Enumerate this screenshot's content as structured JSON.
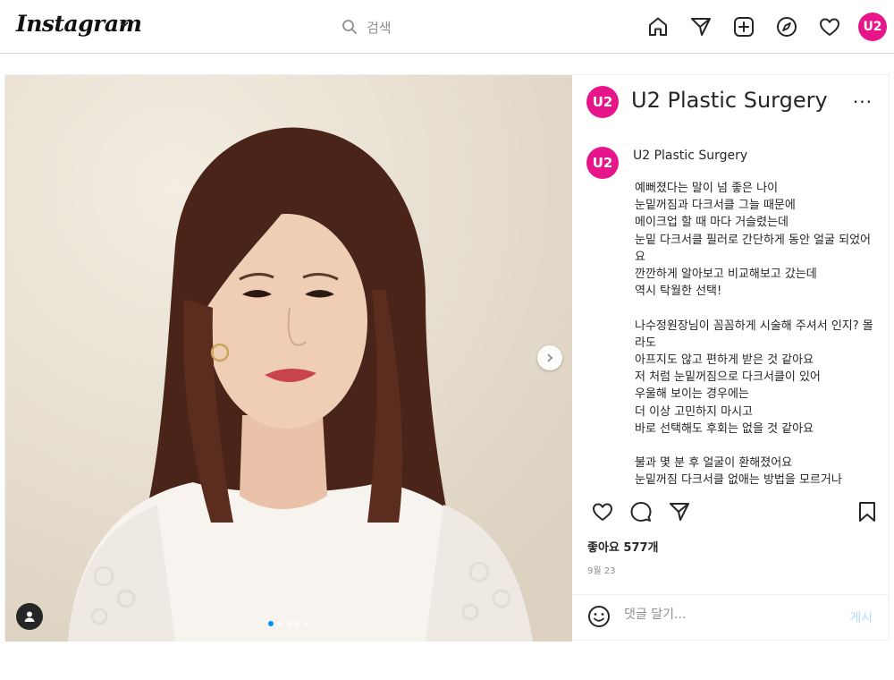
{
  "brand": {
    "logo_text": "Instagram",
    "accent": "#e6168a",
    "link_color": "#0095f6"
  },
  "search": {
    "placeholder": "검색"
  },
  "nav": {
    "icons": [
      "home-icon",
      "direct-message-icon",
      "new-post-icon",
      "explore-icon",
      "activity-heart-icon"
    ],
    "avatar_text": "U2"
  },
  "post": {
    "carousel": {
      "total_slides": 5,
      "active_slide": 1
    },
    "author": {
      "name": "U2 Plastic Surgery",
      "avatar_text": "U2"
    },
    "more_label": "···",
    "caption": "예뻐졌다는 말이 넘 좋은 나이\n눈밑꺼짐과 다크서클 그늘 때문에\n메이크업 할 때 마다 거슬렸는데\n눈밑 다크서클 필러로 간단하게 동안 얼굴 되었어요\n깐깐하게 알아보고 비교해보고 갔는데\n역시 탁월한 선택!\n\n나수정원장님이 꼼꼼하게 시술해 주셔서 인지? 몰라도\n아프지도 않고 편하게 받은 것 같아요\n저 처럼 눈밑꺼짐으로 다크서클이 있어\n우울해 보이는 경우에는\n더 이상 고민하지 마시고\n바로 선택해도 후회는 없을 것 같아요\n\n불과 몇 분 후 얼굴이 환해졌어요\n눈밑꺼짐 다크서클 없애는 방법을 모르거나",
    "likes": "좋아요 577개",
    "date": "9월 23",
    "comment_placeholder": "댓글 달기...",
    "post_button": "게시"
  }
}
